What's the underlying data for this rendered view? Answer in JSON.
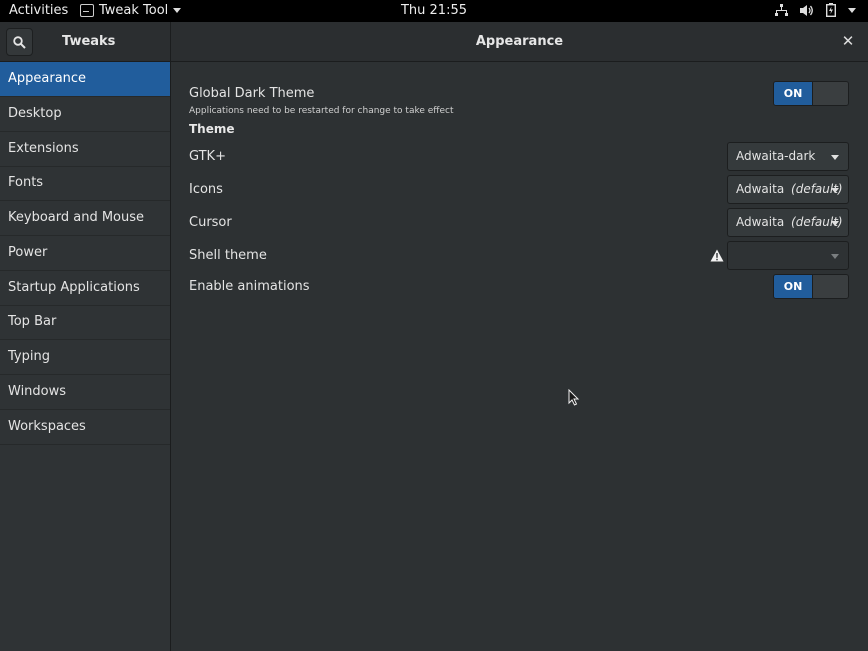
{
  "topbar": {
    "activities": "Activities",
    "app_menu": "Tweak Tool",
    "clock": "Thu 21:55",
    "status_icons": [
      "network-icon",
      "volume-icon",
      "battery-icon",
      "system-menu-caret"
    ]
  },
  "header": {
    "app_title": "Tweaks",
    "page_title": "Appearance",
    "close_glyph": "✕"
  },
  "sidebar": {
    "items": [
      {
        "label": "Appearance",
        "active": true
      },
      {
        "label": "Desktop"
      },
      {
        "label": "Extensions"
      },
      {
        "label": "Fonts"
      },
      {
        "label": "Keyboard and Mouse"
      },
      {
        "label": "Power"
      },
      {
        "label": "Startup Applications"
      },
      {
        "label": "Top Bar"
      },
      {
        "label": "Typing"
      },
      {
        "label": "Windows"
      },
      {
        "label": "Workspaces"
      }
    ]
  },
  "main": {
    "global_dark_theme": {
      "label": "Global Dark Theme",
      "note": "Applications need to be restarted for change to take effect",
      "switch": "ON"
    },
    "theme_heading": "Theme",
    "gtk": {
      "label": "GTK+",
      "value": "Adwaita-dark"
    },
    "icons": {
      "label": "Icons",
      "value": "Adwaita",
      "value_note": "(default)"
    },
    "cursor": {
      "label": "Cursor",
      "value": "Adwaita",
      "value_note": "(default)"
    },
    "shell_theme": {
      "label": "Shell theme",
      "value": ""
    },
    "enable_animations": {
      "label": "Enable animations",
      "switch": "ON"
    }
  },
  "colors": {
    "accent": "#215d9c",
    "background": "#2d3133",
    "sidebar": "#2f3335",
    "topbar": "#000000"
  }
}
